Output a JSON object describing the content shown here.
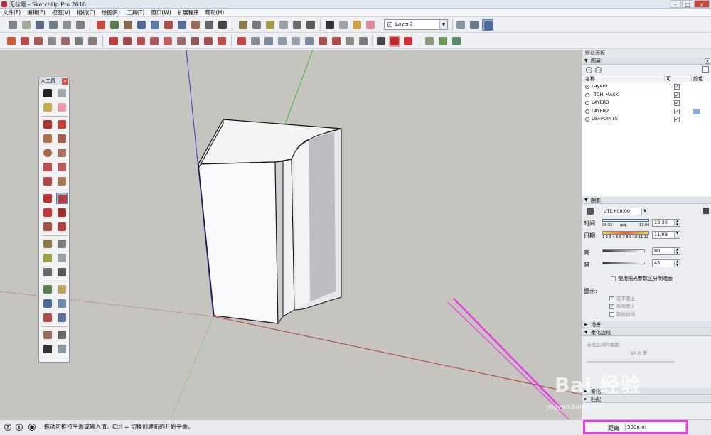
{
  "window": {
    "title": "无标题 - SketchUp Pro 2016",
    "buttons": {
      "minimize": "–",
      "maximize": "□",
      "close": "×"
    }
  },
  "menu": [
    "文件(F)",
    "编辑(E)",
    "视图(V)",
    "相机(C)",
    "绘图(R)",
    "工具(T)",
    "窗口(W)",
    "扩展程序",
    "帮助(H)"
  ],
  "toolbar": {
    "layer_check": "✓",
    "layer_selector": "Layer0",
    "dropdown_arrow": "▼"
  },
  "large_tool_set": {
    "title": "大工具...",
    "close": "×"
  },
  "tray": {
    "title": "默认面板",
    "layers": {
      "header": "图层",
      "col_name": "名称",
      "col_visible": "可...",
      "col_color": "颜色",
      "add_label": "+",
      "remove_label": "−",
      "rows": [
        {
          "name": "Layer0",
          "active": true,
          "visible": true,
          "color": ""
        },
        {
          "name": "_TCH_MASK",
          "active": false,
          "visible": true,
          "color": ""
        },
        {
          "name": "LAYER3",
          "active": false,
          "visible": true,
          "color": ""
        },
        {
          "name": "LAYER2",
          "active": false,
          "visible": true,
          "color": "#8fa8ea"
        },
        {
          "name": "DEFPOINTS",
          "active": false,
          "visible": true,
          "color": ""
        }
      ]
    },
    "shadows": {
      "header": "阴影",
      "timezone": "UTC+08:00",
      "time_label": "时间",
      "time_start": "06:55",
      "time_noon": "中午",
      "time_end": "17:00",
      "time_value": "13:30",
      "date_label": "日期",
      "months": "1 2 3 4 5 6 7 8 9 10 11 12",
      "date_value": "11/08",
      "light_label": "亮",
      "light_value": "80",
      "dark_label": "暗",
      "dark_value": "45",
      "sun_option": "使用阳光参数区分明暗面",
      "display_label": "显示:",
      "display_opts": [
        "在平面上",
        "在地面上",
        "起始边线"
      ]
    },
    "scenes_header": "场景",
    "soften": {
      "header": "柔化边线",
      "angle_label": "法线之间的角度:",
      "angle_value": "20.0 度"
    },
    "fog_header": "雾化",
    "match_header": "匹配"
  },
  "status": {
    "message": "拖动可推拉平面或输入值。Ctrl = 切换创建新的开始平面。",
    "measure_label": "距离",
    "measure_value": "500mm"
  },
  "watermark": {
    "main": "Bai 经验",
    "sub": "jingyan.baidu.com"
  },
  "colors": {
    "viewport_bg": "#c5c4bf",
    "accent_magenta": "#e93ce6",
    "axis_red": "#b43c3c",
    "axis_green": "#3cb43c",
    "axis_blue": "#3c3cd2"
  }
}
